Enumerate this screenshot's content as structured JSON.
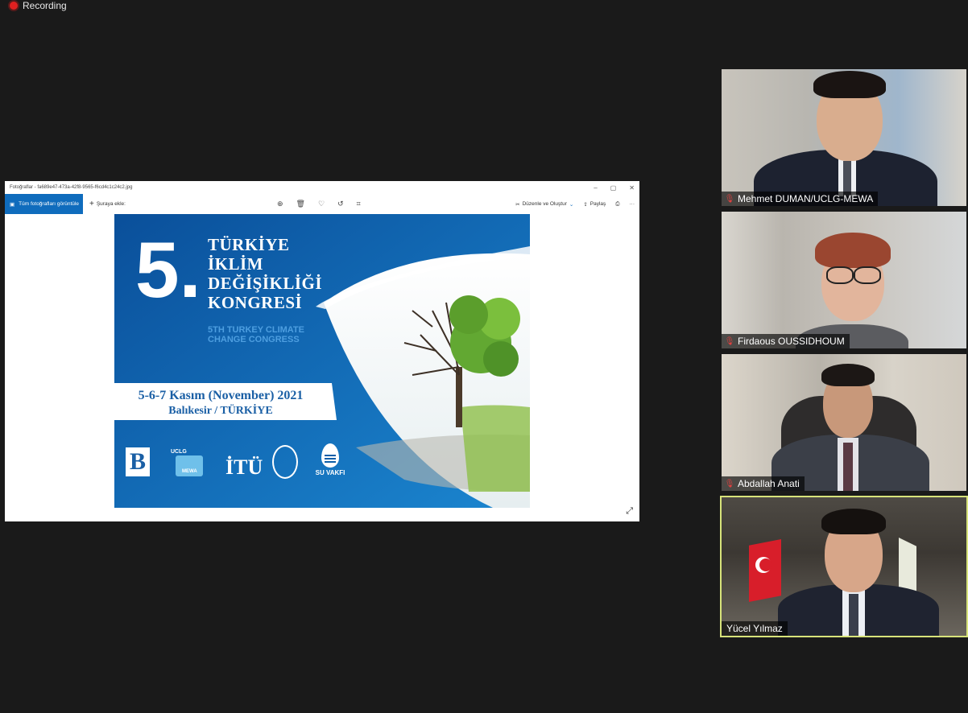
{
  "recording": {
    "label": "Recording"
  },
  "viewer": {
    "title": "Fotoğraflar - fa689e47-473a-42f8-9565-f6cd4c1c24c2.jpg",
    "all_photos_label": "Tüm fotoğrafları görüntüle",
    "add_to_label": "Şuraya ekle:",
    "edit_label": "Düzenle ve Oluştur",
    "share_label": "Paylaş",
    "more_label": "···"
  },
  "poster": {
    "number": "5.",
    "title_lines": [
      "TÜRKİYE",
      "İKLİM",
      "DEĞİŞİKLİĞİ",
      "KONGRESİ"
    ],
    "subtitle_lines": [
      "5TH TURKEY CLIMATE",
      "CHANGE CONGRESS"
    ],
    "date": "5-6-7 Kasım (November) 2021",
    "city": "Balıkesir / TÜRKİYE",
    "logo_uclg": "UCLG",
    "logo_mewa": "MEWA",
    "logo_itu": "İTÜ",
    "logo_su": "SU VAKFI"
  },
  "participants": [
    {
      "name": "Mehmet DUMAN/UCLG-MEWA",
      "muted": true
    },
    {
      "name": "Firdaous OUSSIDHOUM",
      "muted": true
    },
    {
      "name": "Abdallah Anati",
      "muted": true
    },
    {
      "name": "Yücel Yılmaz",
      "muted": false,
      "active_speaker": true
    }
  ],
  "colors": {
    "background": "#1a1a1a",
    "active_speaker_border": "#d7e37a",
    "muted_mic": "#e04040",
    "viewer_accent": "#0f6cbd"
  }
}
